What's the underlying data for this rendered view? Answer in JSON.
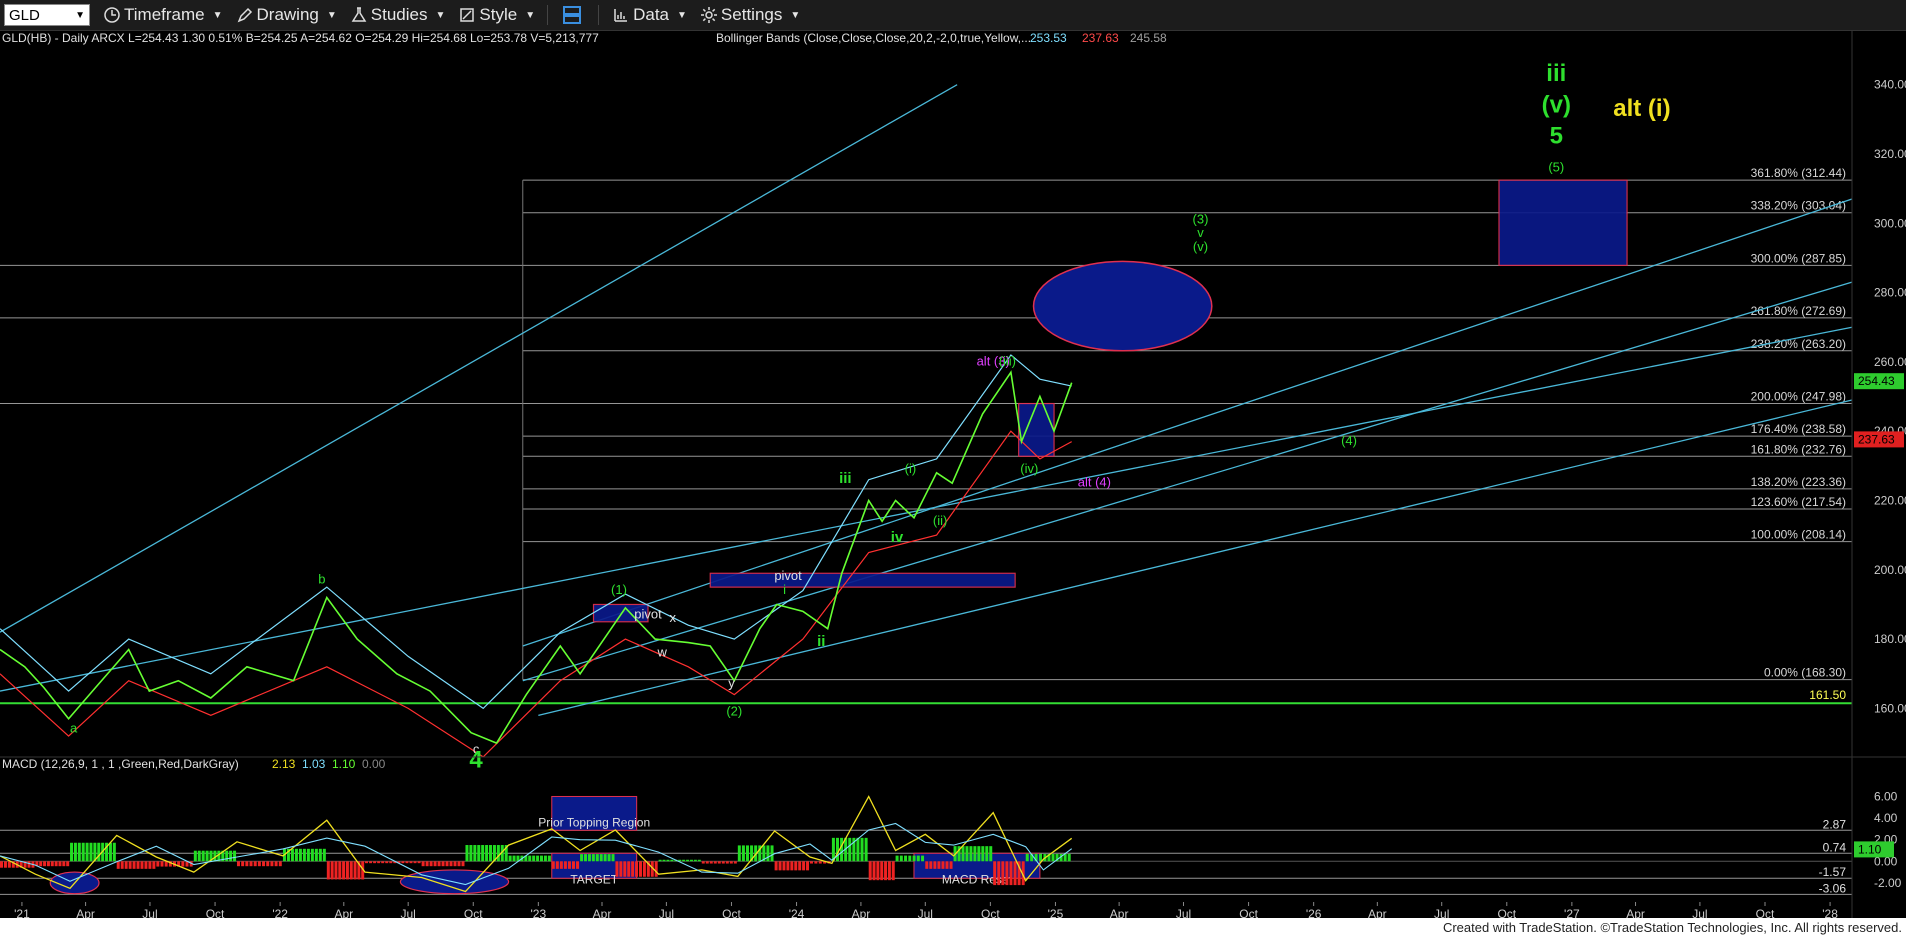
{
  "toolbar": {
    "symbol": "GLD",
    "items": [
      {
        "label": "Timeframe",
        "icon": "clock-icon"
      },
      {
        "label": "Drawing",
        "icon": "pencil-icon"
      },
      {
        "label": "Studies",
        "icon": "flask-icon"
      },
      {
        "label": "Style",
        "icon": "style-icon"
      },
      {
        "label": "",
        "icon": "layout-icon"
      },
      {
        "label": "Data",
        "icon": "bar-chart-icon"
      },
      {
        "label": "Settings",
        "icon": "gear-icon"
      }
    ]
  },
  "header": {
    "price_line": "GLD(HB) - Daily  ARCX  L=254.43  1.30  0.51%  B=254.25  A=254.62  O=254.29  Hi=254.68  Lo=253.78  V=5,213,777",
    "bb_label": "Bollinger Bands (Close,Close,Close,20,2,-2,0,true,Yellow,...",
    "bb_values": [
      "253.53",
      "237.63",
      "245.58"
    ],
    "macd_label": "MACD (12,26,9, 1 , 1 ,Green,Red,DarkGray)",
    "macd_values": [
      "2.13",
      "1.03",
      "1.10",
      "0.00"
    ]
  },
  "footer": "Created with TradeStation. ©TradeStation Technologies, Inc. All rights reserved.",
  "colors": {
    "background": "#000000",
    "price": "#66ff33",
    "bb_upper": "#7fdfff",
    "bb_lower": "#ff3030",
    "wave_green": "#2ecc2e",
    "wave_yellow": "#f0e020",
    "magenta": "#e040ff",
    "box": "#0a1a8a",
    "fib": "#c8c8c8"
  },
  "chart_data": {
    "type": "line",
    "title": "",
    "x_ticks": [
      "'21",
      "Apr",
      "Jul",
      "Oct",
      "'22",
      "Apr",
      "Jul",
      "Oct",
      "'23",
      "Apr",
      "Jul",
      "Oct",
      "'24",
      "Apr",
      "Jul",
      "Oct",
      "'25",
      "Apr",
      "Jul",
      "Oct",
      "'26",
      "Apr",
      "Jul",
      "Oct",
      "'27",
      "Apr",
      "Jul",
      "Oct",
      "'28"
    ],
    "x_range": [
      "2020-12",
      "2028-02"
    ],
    "price_axis": {
      "ylim": [
        148,
        350
      ],
      "ticks": [
        160,
        180,
        200,
        220,
        240,
        260,
        280,
        300,
        320,
        340
      ]
    },
    "price_series": {
      "name": "GLD",
      "dates": [
        "2020-12-01",
        "2021-01-05",
        "2021-02-01",
        "2021-03-08",
        "2021-04-15",
        "2021-06-01",
        "2021-06-30",
        "2021-08-10",
        "2021-09-25",
        "2021-11-15",
        "2022-01-20",
        "2022-03-08",
        "2022-04-20",
        "2022-06-15",
        "2022-08-01",
        "2022-09-28",
        "2022-11-03",
        "2022-12-15",
        "2023-02-01",
        "2023-03-01",
        "2023-05-04",
        "2023-06-15",
        "2023-08-01",
        "2023-09-01",
        "2023-10-05",
        "2023-11-10",
        "2023-12-04",
        "2024-01-10",
        "2024-02-14",
        "2024-03-05",
        "2024-04-12",
        "2024-05-01",
        "2024-05-20",
        "2024-06-15",
        "2024-07-17",
        "2024-08-08",
        "2024-09-20",
        "2024-10-30",
        "2024-11-14",
        "2024-12-10",
        "2024-12-30",
        "2025-01-24"
      ],
      "values": [
        177,
        172,
        166,
        157,
        166,
        177,
        165,
        168,
        163,
        172,
        168,
        192,
        180,
        170,
        165,
        153,
        150,
        164,
        178,
        170,
        189,
        180,
        179,
        178,
        168,
        183,
        190,
        188,
        183,
        199,
        220,
        214,
        220,
        215,
        228,
        225,
        245,
        257,
        237,
        250,
        240,
        254
      ]
    },
    "bb_upper": {
      "name": "BB Upper",
      "dates": [
        "2020-12-01",
        "2021-03-08",
        "2021-06-01",
        "2021-09-25",
        "2022-03-08",
        "2022-07-01",
        "2022-10-15",
        "2023-02-01",
        "2023-05-04",
        "2023-08-01",
        "2023-10-05",
        "2024-01-10",
        "2024-04-12",
        "2024-07-17",
        "2024-10-30",
        "2024-12-10",
        "2025-01-24"
      ],
      "values": [
        183,
        165,
        180,
        170,
        195,
        175,
        160,
        182,
        193,
        184,
        180,
        194,
        226,
        232,
        262,
        255,
        253
      ]
    },
    "bb_lower": {
      "name": "BB Lower",
      "dates": [
        "2020-12-01",
        "2021-03-08",
        "2021-06-01",
        "2021-09-25",
        "2022-03-08",
        "2022-07-01",
        "2022-10-15",
        "2023-02-01",
        "2023-05-04",
        "2023-08-01",
        "2023-10-05",
        "2024-01-10",
        "2024-04-12",
        "2024-07-17",
        "2024-10-30",
        "2024-12-10",
        "2025-01-24"
      ],
      "values": [
        170,
        152,
        168,
        158,
        172,
        160,
        146,
        168,
        180,
        172,
        164,
        180,
        205,
        210,
        240,
        232,
        237
      ]
    },
    "fib_levels": [
      {
        "label": "361.80% (312.44)",
        "value": 312.44
      },
      {
        "label": "338.20% (303.04)",
        "value": 303.04
      },
      {
        "label": "300.00% (287.85)",
        "value": 287.85
      },
      {
        "label": "261.80% (272.69)",
        "value": 272.69
      },
      {
        "label": "238.20% (263.20)",
        "value": 263.2
      },
      {
        "label": "200.00% (247.98)",
        "value": 247.98
      },
      {
        "label": "176.40% (238.58)",
        "value": 238.58
      },
      {
        "label": "161.80% (232.76)",
        "value": 232.76
      },
      {
        "label": "138.20% (223.36)",
        "value": 223.36
      },
      {
        "label": "123.60% (217.54)",
        "value": 217.54
      },
      {
        "label": "100.00% (208.14)",
        "value": 208.14
      },
      {
        "label": "0.00% (168.30)",
        "value": 168.3
      }
    ],
    "support_line": {
      "label": "161.50",
      "value": 161.5
    },
    "last_price": {
      "label": "254.43",
      "value": 254.43
    },
    "bb_lower_last": {
      "label": "237.63",
      "value": 237.63
    },
    "wave_labels": [
      {
        "text": "iii",
        "date": "2026-12-10",
        "value": 341,
        "color": "green",
        "size": "large"
      },
      {
        "text": "(v)",
        "date": "2026-12-10",
        "value": 332,
        "color": "green",
        "size": "large"
      },
      {
        "text": "5",
        "date": "2026-12-10",
        "value": 323,
        "color": "green",
        "size": "large"
      },
      {
        "text": "(5)",
        "date": "2026-12-10",
        "value": 315,
        "color": "green",
        "size": "small"
      },
      {
        "text": "alt (i)",
        "date": "2027-04-10",
        "value": 331,
        "color": "yellow",
        "size": "large"
      },
      {
        "text": "(3)",
        "date": "2025-07-25",
        "value": 300,
        "color": "green",
        "size": "small"
      },
      {
        "text": "v",
        "date": "2025-07-25",
        "value": 296,
        "color": "green",
        "size": "small"
      },
      {
        "text": "(v)",
        "date": "2025-07-25",
        "value": 292,
        "color": "green",
        "size": "small"
      },
      {
        "text": "alt (3)",
        "date": "2024-10-05",
        "value": 259,
        "color": "magenta",
        "size": "small"
      },
      {
        "text": "(iii)",
        "date": "2024-10-25",
        "value": 259,
        "color": "green",
        "size": "small"
      },
      {
        "text": "(iv)",
        "date": "2024-11-25",
        "value": 228,
        "color": "green",
        "size": "small"
      },
      {
        "text": "alt (4)",
        "date": "2025-02-25",
        "value": 224,
        "color": "magenta",
        "size": "small"
      },
      {
        "text": "(4)",
        "date": "2026-02-20",
        "value": 236,
        "color": "green",
        "size": "small"
      },
      {
        "text": "iii",
        "date": "2024-03-10",
        "value": 225,
        "color": "green",
        "size": "medium"
      },
      {
        "text": "(i)",
        "date": "2024-06-10",
        "value": 228,
        "color": "green",
        "size": "small"
      },
      {
        "text": "(ii)",
        "date": "2024-07-22",
        "value": 213,
        "color": "green",
        "size": "small"
      },
      {
        "text": "iv",
        "date": "2024-05-22",
        "value": 208,
        "color": "green",
        "size": "medium"
      },
      {
        "text": "i",
        "date": "2023-12-15",
        "value": 193,
        "color": "green",
        "size": "small"
      },
      {
        "text": "ii",
        "date": "2024-02-05",
        "value": 178,
        "color": "green",
        "size": "medium"
      },
      {
        "text": "(1)",
        "date": "2023-04-25",
        "value": 193,
        "color": "green",
        "size": "small"
      },
      {
        "text": "(2)",
        "date": "2023-10-05",
        "value": 158,
        "color": "green",
        "size": "small"
      },
      {
        "text": "x",
        "date": "2023-07-10",
        "value": 185,
        "color": "white",
        "size": "small"
      },
      {
        "text": "w",
        "date": "2023-06-25",
        "value": 175,
        "color": "white",
        "size": "small"
      },
      {
        "text": "y",
        "date": "2023-10-01",
        "value": 166,
        "color": "white",
        "size": "small"
      },
      {
        "text": "b",
        "date": "2022-03-01",
        "value": 196,
        "color": "green",
        "size": "small"
      },
      {
        "text": "a",
        "date": "2021-03-15",
        "value": 153,
        "color": "green",
        "size": "small"
      },
      {
        "text": "c",
        "date": "2022-10-05",
        "value": 147,
        "color": "white",
        "size": "small"
      },
      {
        "text": "4",
        "date": "2022-10-05",
        "value": 143,
        "color": "green",
        "size": "large"
      },
      {
        "text": "pivot",
        "date": "2023-06-05",
        "value": 186,
        "color": "white",
        "size": "small"
      },
      {
        "text": "pivot",
        "date": "2023-12-20",
        "value": 197,
        "color": "white",
        "size": "small"
      }
    ],
    "target_boxes": [
      {
        "x": [
          "2026-09-20",
          "2027-03-20"
        ],
        "y": [
          287.85,
          312.44
        ]
      },
      {
        "x": [
          "2024-11-10",
          "2024-12-30"
        ],
        "y": [
          232.76,
          247.98
        ]
      },
      {
        "x": [
          "2023-03-20",
          "2023-06-05"
        ],
        "y": [
          185,
          190
        ]
      },
      {
        "x": [
          "2023-09-01",
          "2024-11-05"
        ],
        "y": [
          195,
          199
        ]
      }
    ],
    "target_ellipse": {
      "x": [
        "2024-12-01",
        "2025-08-10"
      ],
      "y": [
        263.2,
        289
      ]
    },
    "macd_axis": {
      "ylim": [
        -3.4,
        6.6
      ],
      "ticks": [
        6.0,
        4.0,
        2.0,
        0.0,
        -2.0
      ],
      "levels": [
        {
          "label": "2.87",
          "value": 2.87
        },
        {
          "label": "0.74",
          "value": 0.74
        },
        {
          "label": "-1.57",
          "value": -1.57
        },
        {
          "label": "-3.06",
          "value": -3.06
        }
      ],
      "last": {
        "label": "1.10",
        "value": 1.1
      }
    },
    "macd_series": {
      "name": "MACD",
      "dates": [
        "2020-12-01",
        "2021-01-20",
        "2021-03-10",
        "2021-05-15",
        "2021-07-10",
        "2021-09-01",
        "2021-11-01",
        "2022-01-05",
        "2022-03-08",
        "2022-05-01",
        "2022-07-20",
        "2022-09-20",
        "2022-11-20",
        "2023-01-20",
        "2023-03-01",
        "2023-04-20",
        "2023-06-20",
        "2023-08-20",
        "2023-10-10",
        "2023-12-01",
        "2024-01-20",
        "2024-02-20",
        "2024-04-12",
        "2024-05-20",
        "2024-07-01",
        "2024-08-10",
        "2024-10-05",
        "2024-11-20",
        "2024-12-15",
        "2025-01-24"
      ],
      "values": [
        0.5,
        -1.2,
        -2.5,
        2.4,
        0.4,
        -1.0,
        1.8,
        0.5,
        3.8,
        -1.0,
        -1.5,
        -2.8,
        1.5,
        3.0,
        1.0,
        2.9,
        -1.2,
        -0.8,
        -1.4,
        2.8,
        0.4,
        -0.2,
        6.0,
        1.0,
        2.5,
        0.5,
        4.5,
        -1.8,
        0.2,
        2.13
      ]
    },
    "macd_annotations": [
      {
        "text": "Prior Topping Region",
        "box": {
          "x": [
            "2023-01-20",
            "2023-05-20"
          ],
          "y": [
            2.87,
            6.0
          ]
        }
      },
      {
        "text": "TARGET",
        "box": {
          "x": [
            "2023-01-20",
            "2023-05-20"
          ],
          "y": [
            -1.57,
            0.74
          ]
        }
      },
      {
        "text": "MACD Reset",
        "box": {
          "x": [
            "2024-06-15",
            "2024-12-10"
          ],
          "y": [
            -1.57,
            0.74
          ]
        }
      }
    ],
    "macd_ellipses": [
      {
        "x": [
          "2021-02-10",
          "2021-04-20"
        ],
        "y": [
          -3.0,
          -1.0
        ]
      },
      {
        "x": [
          "2022-06-20",
          "2022-11-20"
        ],
        "y": [
          -3.0,
          -0.8
        ]
      }
    ]
  }
}
